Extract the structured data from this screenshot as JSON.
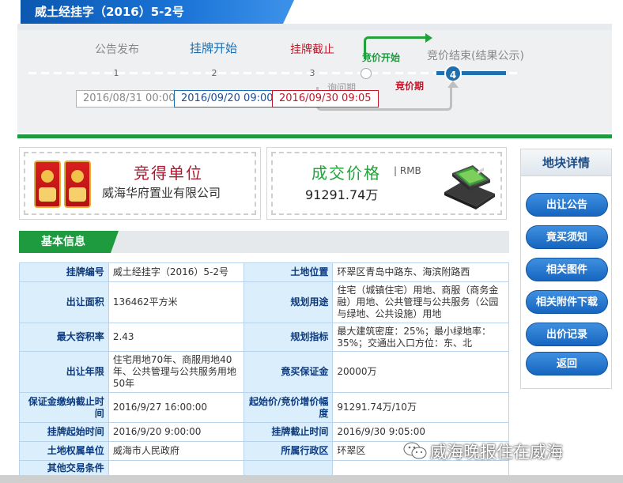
{
  "header": {
    "title": "威土经挂字（2016）5-2号"
  },
  "progress": {
    "steps": [
      {
        "label": "公告发布",
        "num": "1",
        "color": "#888888"
      },
      {
        "label": "挂牌开始",
        "num": "2",
        "color": "#1a6fb4"
      },
      {
        "label": "挂牌截止",
        "num": "3",
        "color": "#c0182a"
      },
      {
        "label": "竞价开始",
        "color": "#1d9b3e"
      },
      {
        "label": "竞价结束(结果公示)",
        "num": "4",
        "color": "#888888"
      }
    ],
    "inquiry_label": "询问期",
    "bidding_label": "竞价期",
    "dates": [
      {
        "text": "2016/08/31 00:00",
        "color": "#888888",
        "border": "#b0b0b0"
      },
      {
        "text": "2016/09/20 09:00",
        "color": "#1a4f9a",
        "border": "#1a6fb4"
      },
      {
        "text": "2016/09/30 09:05",
        "color": "#c0182a",
        "border": "#c0182a"
      }
    ]
  },
  "winner": {
    "title": "竞得单位",
    "name": "威海华府置业有限公司"
  },
  "price": {
    "title": "成交价格",
    "unit": "| RMB",
    "value": "91291.74万"
  },
  "sidebar": {
    "title": "地块详情",
    "buttons": [
      "出让公告",
      "竟买须知",
      "相关图件",
      "相关附件下载",
      "出价记录",
      "返回"
    ]
  },
  "basic": {
    "tab": "基本信息",
    "rows": [
      {
        "k1": "挂牌编号",
        "v1": "威土经挂字（2016）5-2号",
        "k2": "土地位置",
        "v2": "环翠区青岛中路东、海滨附路西"
      },
      {
        "k1": "出让面积",
        "v1": "136462平方米",
        "k2": "规划用途",
        "v2": "住宅（城镇住宅）用地、商服（商务金融）用地、公共管理与公共服务（公园与绿地、公共设施）用地"
      },
      {
        "k1": "最大容积率",
        "v1": "2.43",
        "k2": "规划指标",
        "v2": "最大建筑密度：25%；最小绿地率：35%；交通出入口方位：东、北"
      },
      {
        "k1": "出让年限",
        "v1": "住宅用地70年、商服用地40年、公共管理与公共服务用地50年",
        "k2": "竟买保证金",
        "v2": "20000万"
      },
      {
        "k1": "保证金缴纳截止时间",
        "v1": "2016/9/27 16:00:00",
        "k2": "起始价/竞价增价幅度",
        "v2": "91291.74万/10万"
      },
      {
        "k1": "挂牌起始时间",
        "v1": "2016/9/20 9:00:00",
        "k2": "挂牌截止时间",
        "v2": "2016/9/30 9:05:00"
      },
      {
        "k1": "土地权属单位",
        "v1": "威海市人民政府",
        "k2": "所属行政区",
        "v2": "环翠区"
      },
      {
        "k1": "其他交易条件",
        "v1": "",
        "k2": "",
        "v2": ""
      }
    ]
  },
  "watermark": {
    "text": "威海晚报住在威海"
  }
}
